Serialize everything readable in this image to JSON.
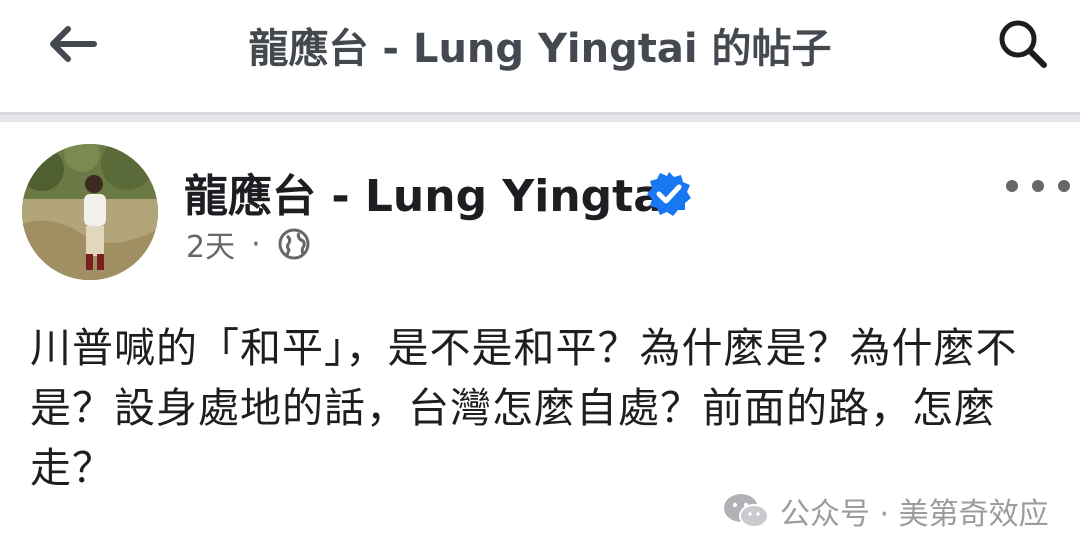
{
  "header": {
    "title": "龍應台 - Lung Yingtai 的帖子"
  },
  "post": {
    "author": "龍應台 - Lung Yingtai",
    "time": "2天",
    "separator": "·",
    "body": "川普喊的「和平」，是不是和平？為什麼是？為什麼不是？設身處地的話，台灣怎麼自處？前面的路，怎麼走？"
  },
  "watermark": {
    "text": "公众号 · 美第奇效应"
  },
  "colors": {
    "verified_blue": "#1877f2",
    "secondary_text": "#65676b"
  },
  "icons": [
    "back-arrow-icon",
    "search-icon",
    "verified-badge-icon",
    "more-dots-icon",
    "globe-icon",
    "wechat-icon"
  ]
}
